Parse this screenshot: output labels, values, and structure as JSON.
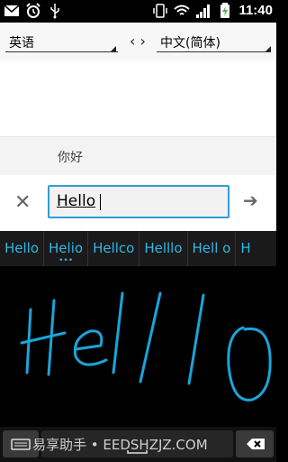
{
  "status_bar": {
    "time": "11:40",
    "left_icons": [
      "gmail-icon",
      "alarm-icon",
      "usb-icon"
    ],
    "right_icons": [
      "vibrate-icon",
      "wifi-icon",
      "signal-icon",
      "battery-charging-icon"
    ]
  },
  "language_bar": {
    "source_language": "英语",
    "target_language": "中文(简体)",
    "swap_symbol": "‹ ›"
  },
  "result": {
    "translation": "你好"
  },
  "edit": {
    "text": "Hello",
    "clear_symbol": "✕",
    "go_symbol": "➔"
  },
  "suggestions": [
    "Hello",
    "Helio",
    "Hellco",
    "Helllo",
    "Hell o",
    "H"
  ],
  "suggestion_dots": "•••",
  "handwriting": {
    "ink_color": "#1aa5d8"
  },
  "watermark": "易享助手 • EEDSHZJZ.COM"
}
